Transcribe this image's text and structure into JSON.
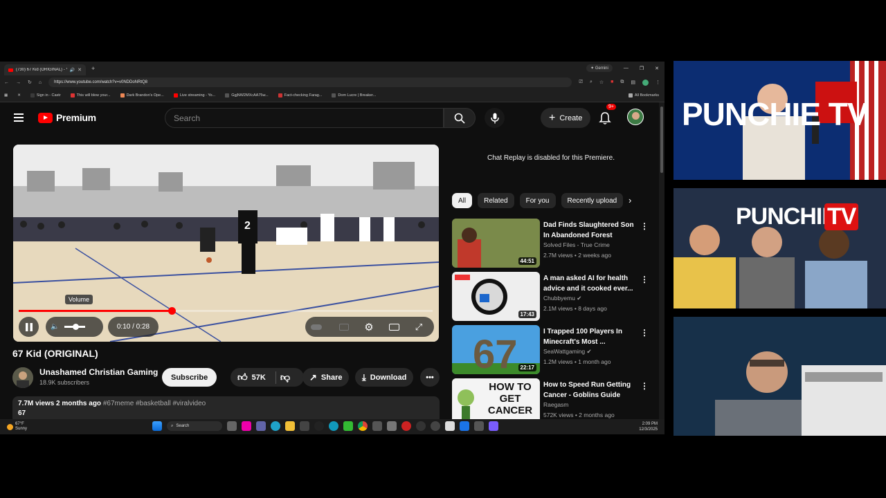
{
  "browser": {
    "tab_title": "(730) 67 Kid (ORIGINAL) - Y",
    "new_tab": "+",
    "gemini_label": "Gemini",
    "url": "https://www.youtube.com/watch?v=v0NDDoNRtQ8",
    "bookmarks": [
      {
        "label": "Sign in - Castr",
        "color": "#3a3a3a"
      },
      {
        "label": "This will blow your...",
        "color": "#d33"
      },
      {
        "label": "Dark Brandon's Ope...",
        "color": "#e85"
      },
      {
        "label": "Live streaming - Yo...",
        "color": "#f00"
      },
      {
        "label": "GgjNW2MXcAA75w...",
        "color": "#333"
      },
      {
        "label": "Fact-checking Farag...",
        "color": "#c33"
      },
      {
        "label": "Dom Lucre | Breaker...",
        "color": "#333"
      }
    ],
    "all_bookmarks": "All Bookmarks"
  },
  "header": {
    "logo_text": "Premium",
    "search_placeholder": "Search",
    "create_label": "Create",
    "notif_badge": "9+"
  },
  "player": {
    "volume_tooltip": "Volume",
    "time": "0:10 / 0:28",
    "progress": 0.37,
    "jersey_number": "2"
  },
  "video": {
    "title": "67 Kid (ORIGINAL)",
    "channel": "Unashamed Christian Gaming",
    "subscribers": "18.9K subscribers",
    "subscribe_label": "Subscribe",
    "likes": "57K",
    "share_label": "Share",
    "download_label": "Download",
    "views_date": "7.7M views  2 months ago",
    "tags": "#67meme #basketball #viralvideo",
    "desc_first": "67"
  },
  "sidebar": {
    "chat_replay": "Chat Replay is disabled for this Premiere.",
    "chips": [
      "All",
      "Related",
      "For you",
      "Recently upload"
    ],
    "recs": [
      {
        "title": "Dad Finds Slaughtered Son In Abandoned Forest",
        "channel": "Solved Files - True Crime",
        "verified": false,
        "meta": "2.7M views • 2 weeks ago",
        "duration": "44:51"
      },
      {
        "title": "A man asked AI for health advice and it cooked ever...",
        "channel": "Chubbyemu",
        "verified": true,
        "meta": "2.1M views • 8 days ago",
        "duration": "17:43"
      },
      {
        "title": "I Trapped 100 Players In Minecraft's Most ...",
        "channel": "SeaWattgaming",
        "verified": true,
        "meta": "1.2M views • 1 month ago",
        "duration": "22:17"
      },
      {
        "title": "How to Speed Run Getting Cancer - Goblins Guide",
        "channel": "Raegasm",
        "verified": false,
        "meta": "572K views • 2 months ago",
        "duration": ""
      }
    ],
    "thumb_text_67": "67",
    "thumb_text_cancer": "HOW TO GET CANCER"
  },
  "taskbar": {
    "temp": "67°F",
    "weather": "Sunny",
    "search": "Search",
    "time": "2:09 PM",
    "date": "12/3/2025"
  },
  "stream": {
    "brand_top": "PUNCHIE TV",
    "brand_mid_1": "PUNCHIE",
    "brand_mid_2": "TV"
  }
}
